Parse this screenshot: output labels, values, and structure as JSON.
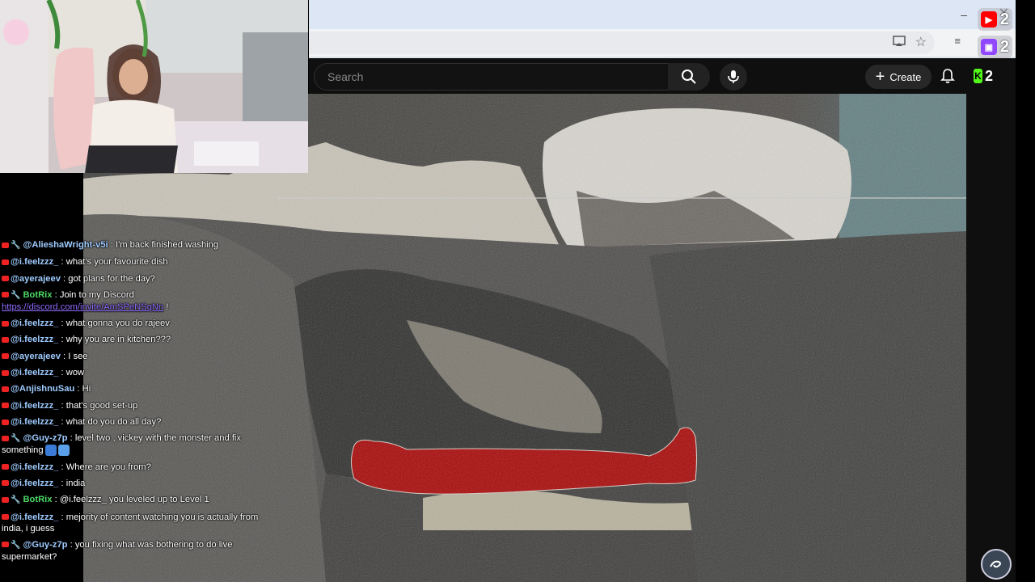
{
  "browser": {
    "minimize_glyph": "–",
    "close_glyph": "✕",
    "icons": [
      "cast-icon",
      "star-icon",
      "extensions-icon"
    ]
  },
  "overlay_badges": [
    {
      "platform": "youtube",
      "count": "2",
      "color": "#ff0000"
    },
    {
      "platform": "twitch",
      "count": "2",
      "color": "#9146ff"
    },
    {
      "platform": "kick",
      "count": "2",
      "color": "#53fc18"
    }
  ],
  "youtube": {
    "search_placeholder": "Search",
    "create_label": "Create",
    "icons": [
      "search-icon",
      "mic-icon",
      "bell-icon"
    ]
  },
  "chat": {
    "messages": [
      {
        "user": "@AlieshaWright-v5i",
        "user_color": "#9ecbff",
        "mod": true,
        "text": "I'm back finished washing"
      },
      {
        "user": "@i.feelzzz_",
        "user_color": "#9ecbff",
        "mod": false,
        "text": "what's your favourite dish"
      },
      {
        "user": "@ayerajeev",
        "user_color": "#9ecbff",
        "mod": false,
        "text": "got plans for the day?"
      },
      {
        "user": "BotRix",
        "user_color": "#4cd964",
        "mod": true,
        "text": "Join to my Discord",
        "link": "https://discord.com/invite/AmSPeNSqNn",
        "after": "!"
      },
      {
        "user": "@i.feelzzz_",
        "user_color": "#9ecbff",
        "mod": false,
        "text": "what gonna you do rajeev"
      },
      {
        "user": "@i.feelzzz_",
        "user_color": "#9ecbff",
        "mod": false,
        "text": "why you are in kitchen???"
      },
      {
        "user": "@ayerajeev",
        "user_color": "#9ecbff",
        "mod": false,
        "text": "I see"
      },
      {
        "user": "@i.feelzzz_",
        "user_color": "#9ecbff",
        "mod": false,
        "text": "wow"
      },
      {
        "user": "@AnjishnuSau",
        "user_color": "#9ecbff",
        "mod": false,
        "text": "Hi"
      },
      {
        "user": "@i.feelzzz_",
        "user_color": "#9ecbff",
        "mod": false,
        "text": "that's good set-up"
      },
      {
        "user": "@i.feelzzz_",
        "user_color": "#9ecbff",
        "mod": false,
        "text": "what do you do all day?"
      },
      {
        "user": "@Guy-z7p",
        "user_color": "#9ecbff",
        "mod": true,
        "text": "level two , vickey with the monster and fix something",
        "emojis": true
      },
      {
        "user": "@i.feelzzz_",
        "user_color": "#9ecbff",
        "mod": false,
        "text": "Where are you from?"
      },
      {
        "user": "@i.feelzzz_",
        "user_color": "#9ecbff",
        "mod": false,
        "text": "india"
      },
      {
        "user": "BotRix",
        "user_color": "#4cd964",
        "mod": true,
        "text": "@i.feelzzz_ you leveled up to Level 1"
      },
      {
        "user": "@i.feelzzz_",
        "user_color": "#9ecbff",
        "mod": false,
        "text": "mejority of content watching you is actually from india, i guess"
      },
      {
        "user": "@Guy-z7p",
        "user_color": "#9ecbff",
        "mod": true,
        "text": "you fixing what was bothering to do live supermarket?"
      }
    ]
  },
  "colors": {
    "yt_bg": "#0f0f0f",
    "figure_red": "#a80000"
  }
}
